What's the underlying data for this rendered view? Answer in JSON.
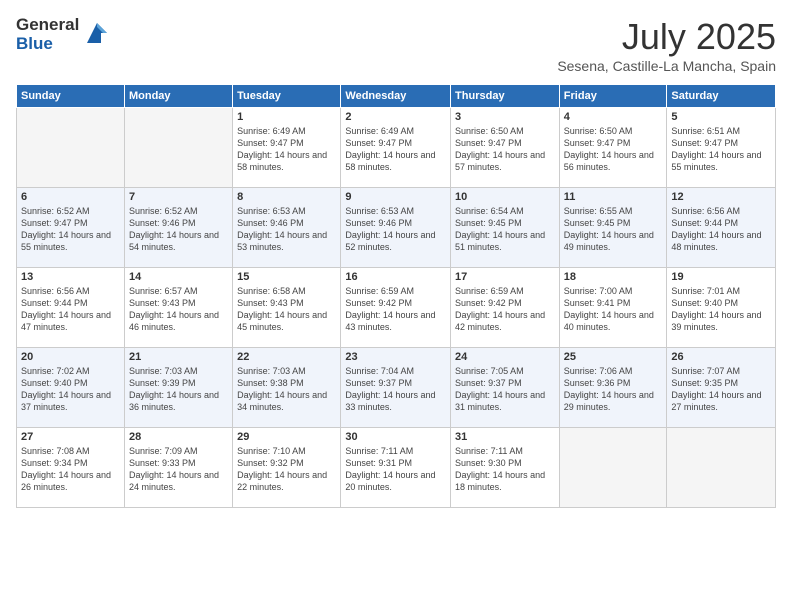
{
  "logo": {
    "general": "General",
    "blue": "Blue"
  },
  "title": "July 2025",
  "subtitle": "Sesena, Castille-La Mancha, Spain",
  "weekdays": [
    "Sunday",
    "Monday",
    "Tuesday",
    "Wednesday",
    "Thursday",
    "Friday",
    "Saturday"
  ],
  "weeks": [
    [
      {
        "day": "",
        "empty": true
      },
      {
        "day": "",
        "empty": true
      },
      {
        "day": "1",
        "sunrise": "6:49 AM",
        "sunset": "9:47 PM",
        "daylight": "14 hours and 58 minutes."
      },
      {
        "day": "2",
        "sunrise": "6:49 AM",
        "sunset": "9:47 PM",
        "daylight": "14 hours and 58 minutes."
      },
      {
        "day": "3",
        "sunrise": "6:50 AM",
        "sunset": "9:47 PM",
        "daylight": "14 hours and 57 minutes."
      },
      {
        "day": "4",
        "sunrise": "6:50 AM",
        "sunset": "9:47 PM",
        "daylight": "14 hours and 56 minutes."
      },
      {
        "day": "5",
        "sunrise": "6:51 AM",
        "sunset": "9:47 PM",
        "daylight": "14 hours and 55 minutes."
      }
    ],
    [
      {
        "day": "6",
        "sunrise": "6:52 AM",
        "sunset": "9:47 PM",
        "daylight": "14 hours and 55 minutes."
      },
      {
        "day": "7",
        "sunrise": "6:52 AM",
        "sunset": "9:46 PM",
        "daylight": "14 hours and 54 minutes."
      },
      {
        "day": "8",
        "sunrise": "6:53 AM",
        "sunset": "9:46 PM",
        "daylight": "14 hours and 53 minutes."
      },
      {
        "day": "9",
        "sunrise": "6:53 AM",
        "sunset": "9:46 PM",
        "daylight": "14 hours and 52 minutes."
      },
      {
        "day": "10",
        "sunrise": "6:54 AM",
        "sunset": "9:45 PM",
        "daylight": "14 hours and 51 minutes."
      },
      {
        "day": "11",
        "sunrise": "6:55 AM",
        "sunset": "9:45 PM",
        "daylight": "14 hours and 49 minutes."
      },
      {
        "day": "12",
        "sunrise": "6:56 AM",
        "sunset": "9:44 PM",
        "daylight": "14 hours and 48 minutes."
      }
    ],
    [
      {
        "day": "13",
        "sunrise": "6:56 AM",
        "sunset": "9:44 PM",
        "daylight": "14 hours and 47 minutes."
      },
      {
        "day": "14",
        "sunrise": "6:57 AM",
        "sunset": "9:43 PM",
        "daylight": "14 hours and 46 minutes."
      },
      {
        "day": "15",
        "sunrise": "6:58 AM",
        "sunset": "9:43 PM",
        "daylight": "14 hours and 45 minutes."
      },
      {
        "day": "16",
        "sunrise": "6:59 AM",
        "sunset": "9:42 PM",
        "daylight": "14 hours and 43 minutes."
      },
      {
        "day": "17",
        "sunrise": "6:59 AM",
        "sunset": "9:42 PM",
        "daylight": "14 hours and 42 minutes."
      },
      {
        "day": "18",
        "sunrise": "7:00 AM",
        "sunset": "9:41 PM",
        "daylight": "14 hours and 40 minutes."
      },
      {
        "day": "19",
        "sunrise": "7:01 AM",
        "sunset": "9:40 PM",
        "daylight": "14 hours and 39 minutes."
      }
    ],
    [
      {
        "day": "20",
        "sunrise": "7:02 AM",
        "sunset": "9:40 PM",
        "daylight": "14 hours and 37 minutes."
      },
      {
        "day": "21",
        "sunrise": "7:03 AM",
        "sunset": "9:39 PM",
        "daylight": "14 hours and 36 minutes."
      },
      {
        "day": "22",
        "sunrise": "7:03 AM",
        "sunset": "9:38 PM",
        "daylight": "14 hours and 34 minutes."
      },
      {
        "day": "23",
        "sunrise": "7:04 AM",
        "sunset": "9:37 PM",
        "daylight": "14 hours and 33 minutes."
      },
      {
        "day": "24",
        "sunrise": "7:05 AM",
        "sunset": "9:37 PM",
        "daylight": "14 hours and 31 minutes."
      },
      {
        "day": "25",
        "sunrise": "7:06 AM",
        "sunset": "9:36 PM",
        "daylight": "14 hours and 29 minutes."
      },
      {
        "day": "26",
        "sunrise": "7:07 AM",
        "sunset": "9:35 PM",
        "daylight": "14 hours and 27 minutes."
      }
    ],
    [
      {
        "day": "27",
        "sunrise": "7:08 AM",
        "sunset": "9:34 PM",
        "daylight": "14 hours and 26 minutes."
      },
      {
        "day": "28",
        "sunrise": "7:09 AM",
        "sunset": "9:33 PM",
        "daylight": "14 hours and 24 minutes."
      },
      {
        "day": "29",
        "sunrise": "7:10 AM",
        "sunset": "9:32 PM",
        "daylight": "14 hours and 22 minutes."
      },
      {
        "day": "30",
        "sunrise": "7:11 AM",
        "sunset": "9:31 PM",
        "daylight": "14 hours and 20 minutes."
      },
      {
        "day": "31",
        "sunrise": "7:11 AM",
        "sunset": "9:30 PM",
        "daylight": "14 hours and 18 minutes."
      },
      {
        "day": "",
        "empty": true
      },
      {
        "day": "",
        "empty": true
      }
    ]
  ]
}
